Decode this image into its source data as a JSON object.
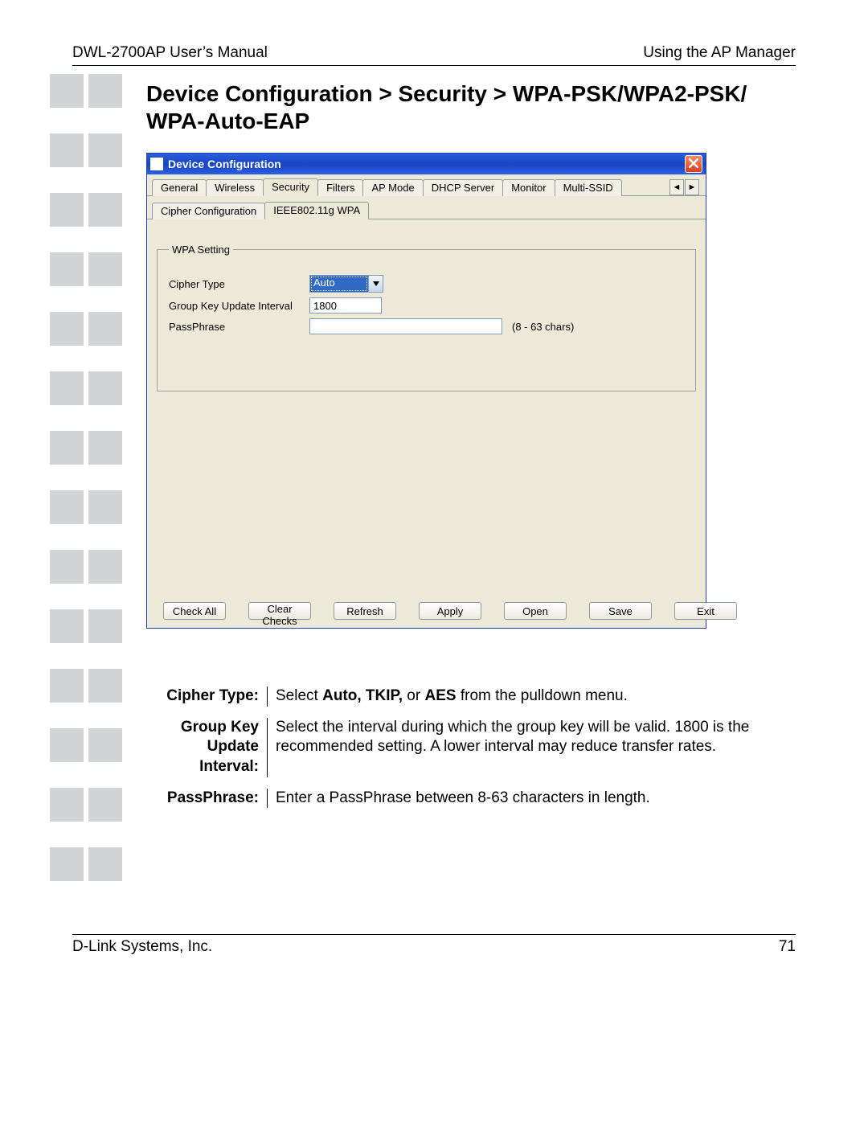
{
  "header": {
    "left": "DWL-2700AP User’s Manual",
    "right": "Using the AP Manager"
  },
  "footer": {
    "left": "D-Link Systems, Inc.",
    "right": "71"
  },
  "page_title": "Device Configuration > Security > WPA-PSK/WPA2-PSK/ WPA-Auto-EAP",
  "dialog": {
    "title": "Device Configuration",
    "tabs": [
      "General",
      "Wireless",
      "Security",
      "Filters",
      "AP Mode",
      "DHCP Server",
      "Monitor",
      "Multi-SSID"
    ],
    "active_tab": "Security",
    "subtabs": [
      "Cipher Configuration",
      "IEEE802.11g WPA"
    ],
    "active_subtab": "IEEE802.11g WPA",
    "fieldset_legend": "WPA Setting",
    "form": {
      "cipher_type_label": "Cipher Type",
      "cipher_type_value": "Auto",
      "gkui_label": "Group Key Update Interval",
      "gkui_value": "1800",
      "pass_label": "PassPhrase",
      "pass_value": "",
      "pass_hint": "(8 - 63 chars)"
    },
    "buttons": [
      "Check All",
      "Clear Checks",
      "Refresh",
      "Apply",
      "Open",
      "Save",
      "Exit"
    ],
    "scroll_left": "◄",
    "scroll_right": "►"
  },
  "descriptions": [
    {
      "term": "Cipher Type:",
      "def_prefix": "Select ",
      "def_bold": "Auto, TKIP,",
      "def_mid": " or ",
      "def_bold2": "AES",
      "def_suffix": " from the pulldown menu."
    },
    {
      "term": "Group Key Update Interval:",
      "def_plain": "Select the interval during which the group key will be valid. 1800 is the recommended setting. A lower interval may reduce transfer rates."
    },
    {
      "term": "PassPhrase:",
      "def_plain": "Enter a PassPhrase between 8-63 characters in length."
    }
  ]
}
